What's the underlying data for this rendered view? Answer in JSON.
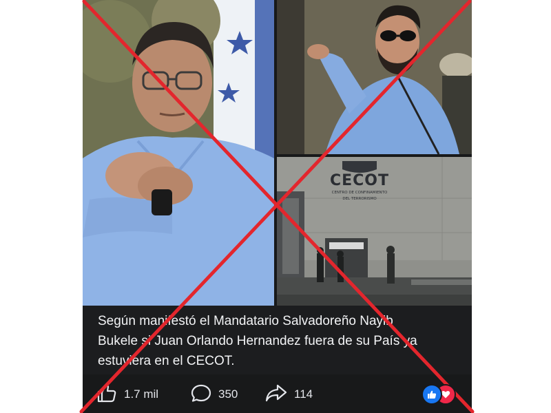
{
  "post": {
    "caption": {
      "line1": "Según manifestó el Mandatario Salvadoreño Nayib",
      "line2": "Bukele si Juan Orlando Hernandez fuera de su País ya",
      "line3": "estuviera en el CECOT."
    },
    "images": {
      "sign_title": "CECOT",
      "sign_subtitle_1": "CENTRO DE CONFINAMIENTO",
      "sign_subtitle_2": "DEL TERRORISMO"
    },
    "actions": {
      "likes": "1.7 mil",
      "comments": "350",
      "shares": "114"
    },
    "reactions": [
      "like-icon",
      "love-icon"
    ]
  },
  "overlay": {
    "cross_color": "#e3262d"
  },
  "colors": {
    "post_background": "#18191a",
    "caption_text": "#f2f3f5",
    "like_blue": "#1877f2",
    "love_red": "#f02849"
  }
}
